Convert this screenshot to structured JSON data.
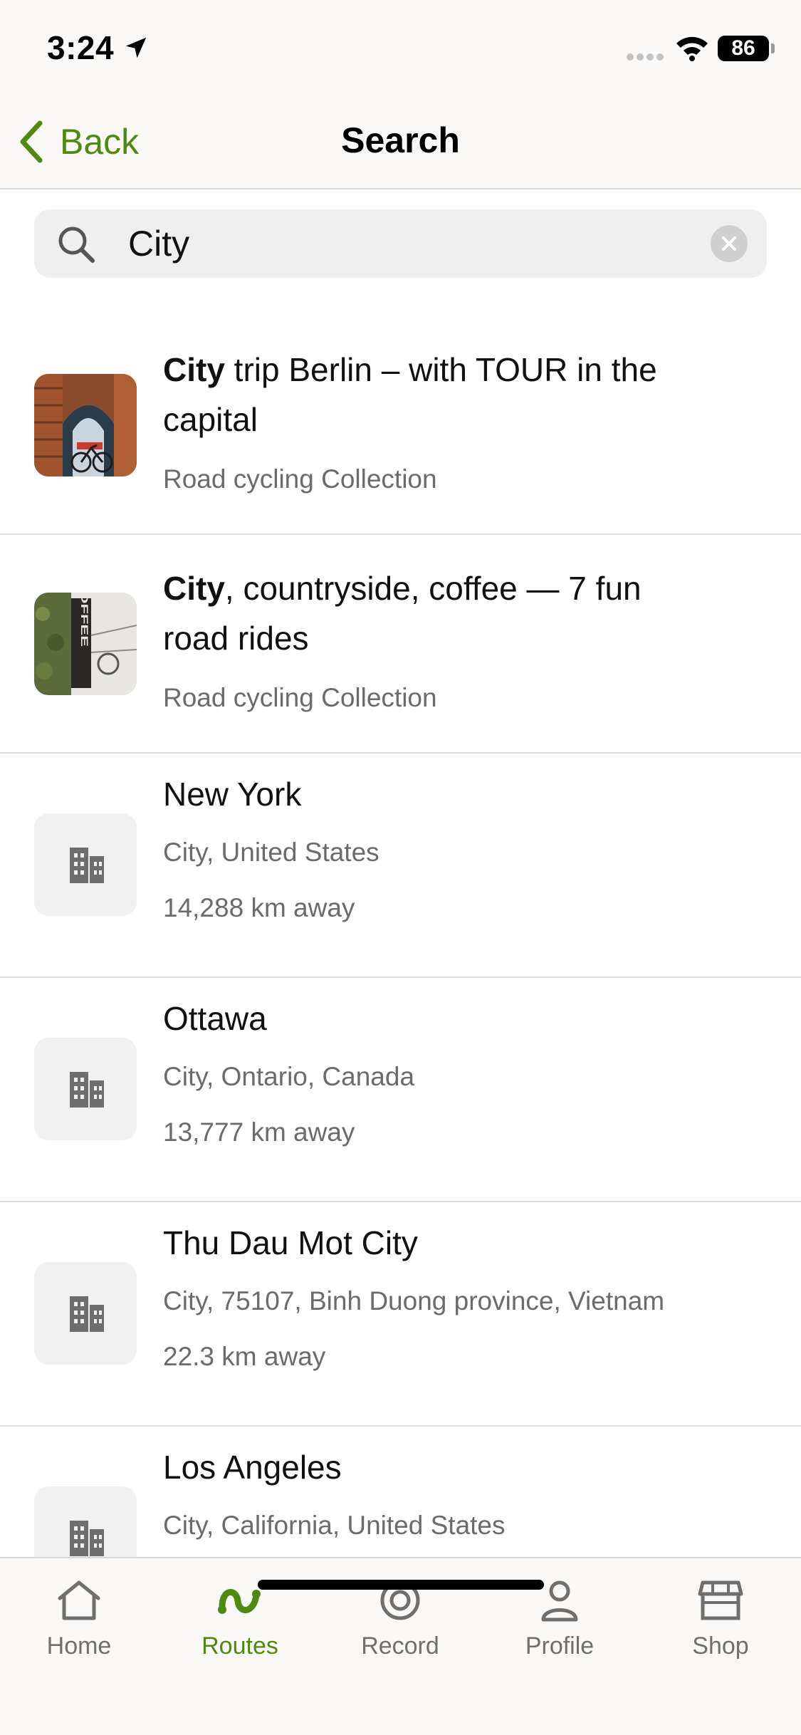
{
  "status_bar": {
    "time": "3:24",
    "battery": "86"
  },
  "nav": {
    "back_label": "Back",
    "title": "Search"
  },
  "search": {
    "value": "City",
    "placeholder": ""
  },
  "results": [
    {
      "kind": "collection",
      "title_bold": "City",
      "title_rest": " trip Berlin – with TOUR in the capital",
      "subtitle": "Road cycling Collection",
      "thumbnail": "berlin-brick-archway-bike-photo"
    },
    {
      "kind": "collection",
      "title_bold": "City",
      "title_rest": ", countryside, coffee — 7 fun road rides",
      "subtitle": "Road cycling Collection",
      "thumbnail": "coffee-sign-photo",
      "thumbnail_text": "COFFEE"
    },
    {
      "kind": "place",
      "title": "New York",
      "subtitle": "City, United States",
      "distance": "14,288 km away",
      "icon": "city-buildings-icon"
    },
    {
      "kind": "place",
      "title": "Ottawa",
      "subtitle": "City, Ontario, Canada",
      "distance": "13,777 km away",
      "icon": "city-buildings-icon"
    },
    {
      "kind": "place",
      "title": "Thu Dau Mot City",
      "subtitle": "City, 75107, Binh Duong province, Vietnam",
      "distance": "22.3 km away",
      "icon": "city-buildings-icon"
    },
    {
      "kind": "place",
      "title": "Los Angeles",
      "subtitle": "City, California, United States",
      "distance": "",
      "icon": "city-buildings-icon"
    }
  ],
  "tabs": [
    {
      "label": "Home",
      "icon": "home-icon",
      "active": false
    },
    {
      "label": "Routes",
      "icon": "routes-icon",
      "active": true
    },
    {
      "label": "Record",
      "icon": "record-icon",
      "active": false
    },
    {
      "label": "Profile",
      "icon": "profile-icon",
      "active": false
    },
    {
      "label": "Shop",
      "icon": "shop-icon",
      "active": false
    }
  ],
  "colors": {
    "accent": "#4f8a10",
    "secondary_text": "#6b6b6b",
    "bar_background": "#f9f8f6"
  }
}
